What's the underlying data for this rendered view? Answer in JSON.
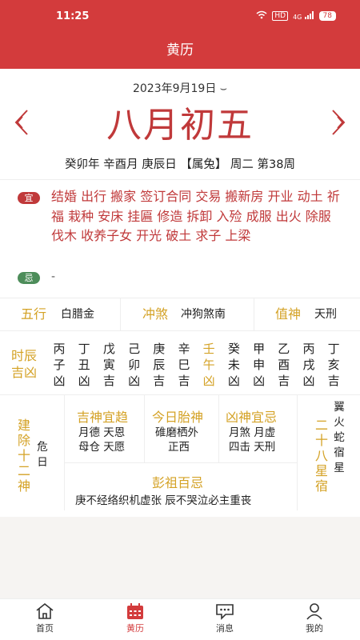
{
  "status": {
    "time": "11:25",
    "hd": "HD",
    "signal": "4G",
    "battery": "78"
  },
  "appbar": {
    "title": "黄历"
  },
  "header": {
    "solar_date": "2023年9月19日 ⌣",
    "lunar_date": "八月初五",
    "ganzhi": "癸卯年 辛酉月 庚辰日 【属兔】 周二 第38周"
  },
  "yi": {
    "badge": "宜",
    "text": "结婚 出行 搬家 签订合同 交易 搬新房 开业 动土 祈福 栽种 安床 挂匾 修造 拆卸 入殓 成服 出火 除服 伐木 收养子女 开光 破土 求子 上梁"
  },
  "ji": {
    "badge": "忌",
    "text": "-"
  },
  "info3": {
    "wuxing_label": "五行",
    "wuxing_value": "白腊金",
    "chongsha_label": "冲煞",
    "chongsha_value": "冲狗煞南",
    "zhishen_label": "值神",
    "zhishen_value": "天刑"
  },
  "shichen": {
    "title": "时辰吉凶",
    "items": [
      {
        "gan": "丙",
        "zhi": "子",
        "luck": "凶"
      },
      {
        "gan": "丁",
        "zhi": "丑",
        "luck": "凶"
      },
      {
        "gan": "戊",
        "zhi": "寅",
        "luck": "吉"
      },
      {
        "gan": "己",
        "zhi": "卯",
        "luck": "凶"
      },
      {
        "gan": "庚",
        "zhi": "辰",
        "luck": "吉"
      },
      {
        "gan": "辛",
        "zhi": "巳",
        "luck": "吉"
      },
      {
        "gan": "壬",
        "zhi": "午",
        "luck": "凶"
      },
      {
        "gan": "癸",
        "zhi": "未",
        "luck": "凶"
      },
      {
        "gan": "甲",
        "zhi": "申",
        "luck": "凶"
      },
      {
        "gan": "乙",
        "zhi": "酉",
        "luck": "吉"
      },
      {
        "gan": "丙",
        "zhi": "戌",
        "luck": "凶"
      },
      {
        "gan": "丁",
        "zhi": "亥",
        "luck": "吉"
      }
    ]
  },
  "jianchu": {
    "title": "建除十二神",
    "value": "危日"
  },
  "jishen": {
    "title": "吉神宜趋",
    "line1": "月德 天恩",
    "line2": "母仓 天愿"
  },
  "taishen": {
    "title": "今日胎神",
    "line1": "碓磨栖外",
    "line2": "正西"
  },
  "xiongshen": {
    "title": "凶神宜忌",
    "line1": "月煞 月虚",
    "line2": "四击 天刑"
  },
  "xingsu": {
    "title": "二十八星宿",
    "value": "翼火蛇宿星"
  },
  "pengzu": {
    "title": "彭祖百忌",
    "text": "庚不经络织机虚张 辰不哭泣必主重丧"
  },
  "tabs": [
    {
      "label": "首页",
      "icon": "home-icon"
    },
    {
      "label": "黄历",
      "icon": "calendar-icon"
    },
    {
      "label": "消息",
      "icon": "message-icon"
    },
    {
      "label": "我的",
      "icon": "user-icon"
    }
  ],
  "colors": {
    "primary": "#d33b3c",
    "gold": "#d4a226",
    "ji_green": "#4d8d5a"
  }
}
